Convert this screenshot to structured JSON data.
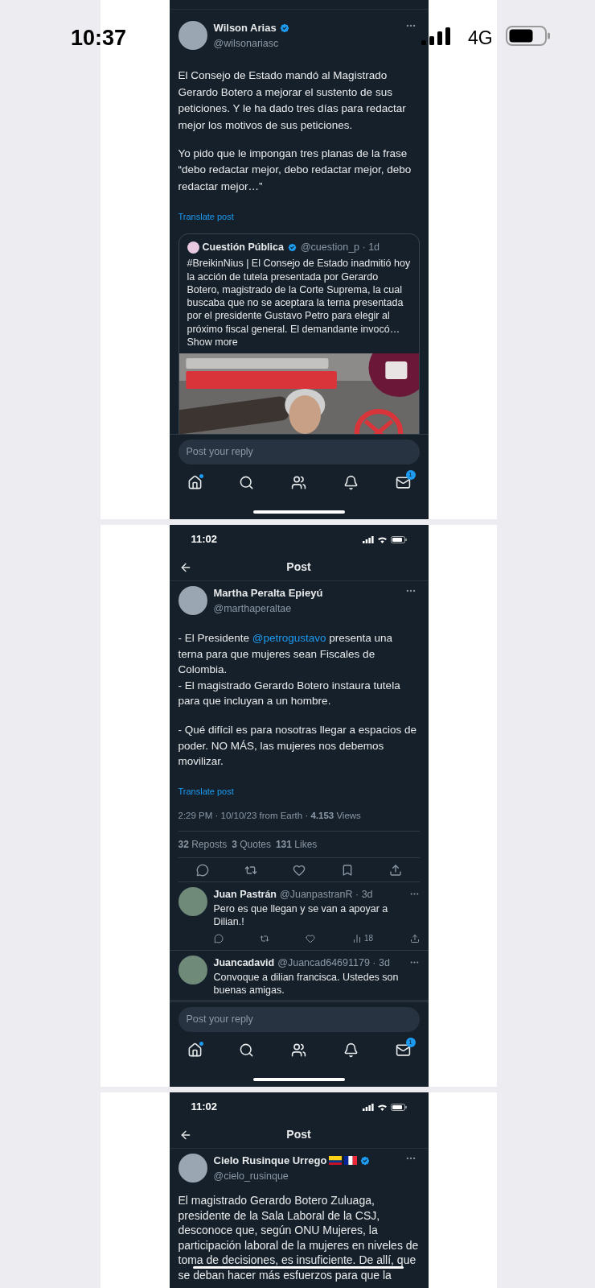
{
  "overlay_status": {
    "time": "10:37",
    "network": "4G"
  },
  "screens": [
    {
      "tweet": {
        "name": "Wilson Arias",
        "verified": true,
        "handle": "@wilsonariasc",
        "blocks": [
          [
            [
              {
                "kind": "text",
                "text": "El Consejo de Estado mandó al Magistrado Gerardo Botero a mejorar el sustento de sus peticiones. Y le ha dado tres días para redactar mejor los motivos de sus peticiones."
              }
            ]
          ],
          [
            [
              {
                "kind": "text",
                "text": "Yo pido que le impongan tres planas de la frase “debo redactar mejor, debo redactar mejor, debo redactar mejor…”"
              }
            ]
          ]
        ],
        "translate": "Translate post",
        "quote": {
          "name": "Cuestión Pública",
          "verified": true,
          "handle_time": "@cuestion_p · 1d",
          "text": "#BreikinNius | El Consejo de Estado inadmitió hoy la acción de tutela presentada por Gerardo Botero, magistrado de la Corte Suprema, la cual buscaba que no se aceptara la terna presentada por el presidente Gustavo Petro para elegir al próximo fiscal general. El demandante invocó…",
          "more": "Show more"
        }
      },
      "footer": {
        "placeholder": "Post your reply",
        "nav": [
          {
            "kind": "home",
            "notification_dot": true
          },
          {
            "kind": "search",
            "notification_dot": false
          },
          {
            "kind": "people",
            "notification_dot": false
          },
          {
            "kind": "bell",
            "notification_dot": false
          },
          {
            "kind": "mail",
            "notification_dot": false,
            "badge": "1"
          }
        ]
      }
    },
    {
      "status_time": "11:02",
      "title": "Post",
      "tweet": {
        "name": "Martha Peralta Epieyú",
        "verified": false,
        "handle": "@marthaperaltae",
        "blocks": [
          [
            [
              {
                "kind": "text",
                "text": "- El Presidente "
              },
              {
                "kind": "mention",
                "text": "@petrogustavo"
              },
              {
                "kind": "text",
                "text": " presenta una terna para que mujeres sean Fiscales de Colombia."
              }
            ],
            [
              {
                "kind": "text",
                "text": "- El magistrado Gerardo Botero instaura tutela para que incluyan a un hombre."
              }
            ]
          ],
          [
            [
              {
                "kind": "text",
                "text": "- Qué difícil es para nosotras llegar a espacios de poder. NO MÁS, las mujeres nos debemos movilizar."
              }
            ]
          ]
        ],
        "translate": "Translate post",
        "meta": "2:29 PM · 10/10/23 from Earth · **4.153** Views",
        "stats": [
          "**32** Reposts",
          "**3** Quotes",
          "**131** Likes"
        ],
        "actions": [
          {
            "kind": "reply"
          },
          {
            "kind": "repost"
          },
          {
            "kind": "like"
          },
          {
            "kind": "bookmark"
          },
          {
            "kind": "share"
          }
        ]
      },
      "replies": [
        {
          "name": "Juan Pastrán",
          "handle_time": "@JuanpastranR · 3d",
          "text": "Pero es que llegan y se van a apoyar a Dilian.!",
          "actions": [
            {
              "kind": "reply"
            },
            {
              "kind": "repost"
            },
            {
              "kind": "like"
            },
            {
              "kind": "views",
              "count": "18"
            },
            {
              "kind": "share"
            }
          ]
        },
        {
          "name": "Juancadavid",
          "handle_time": "@Juancad64691179 · 3d",
          "text": "Convoque a dilian francisca. Ustedes son buenas amigas."
        }
      ],
      "footer": {
        "placeholder": "Post your reply",
        "nav": [
          {
            "kind": "home",
            "notification_dot": true
          },
          {
            "kind": "search",
            "notification_dot": false
          },
          {
            "kind": "people",
            "notification_dot": false
          },
          {
            "kind": "bell",
            "notification_dot": false
          },
          {
            "kind": "mail",
            "notification_dot": false,
            "badge": "1"
          }
        ]
      }
    },
    {
      "status_time": "11:02",
      "title": "Post",
      "home_indicator": true,
      "tweet": {
        "name": "Cielo Rusinque Urrego",
        "flags": [
          {
            "kind": "colombia"
          },
          {
            "kind": "france"
          }
        ],
        "verified": true,
        "handle": "@cielo_rusinque",
        "blocks": [
          [
            [
              {
                "kind": "text",
                "text": "El magistrado Gerardo Botero Zuluaga, presidente de la Sala Laboral de la CSJ, desconoce que, según ONU Mujeres, la participación laboral de la mujeres en niveles de toma de decisiones, es insuficiente. De allí, que se deban hacer más esfuerzos para que la"
              }
            ]
          ]
        ]
      }
    }
  ]
}
